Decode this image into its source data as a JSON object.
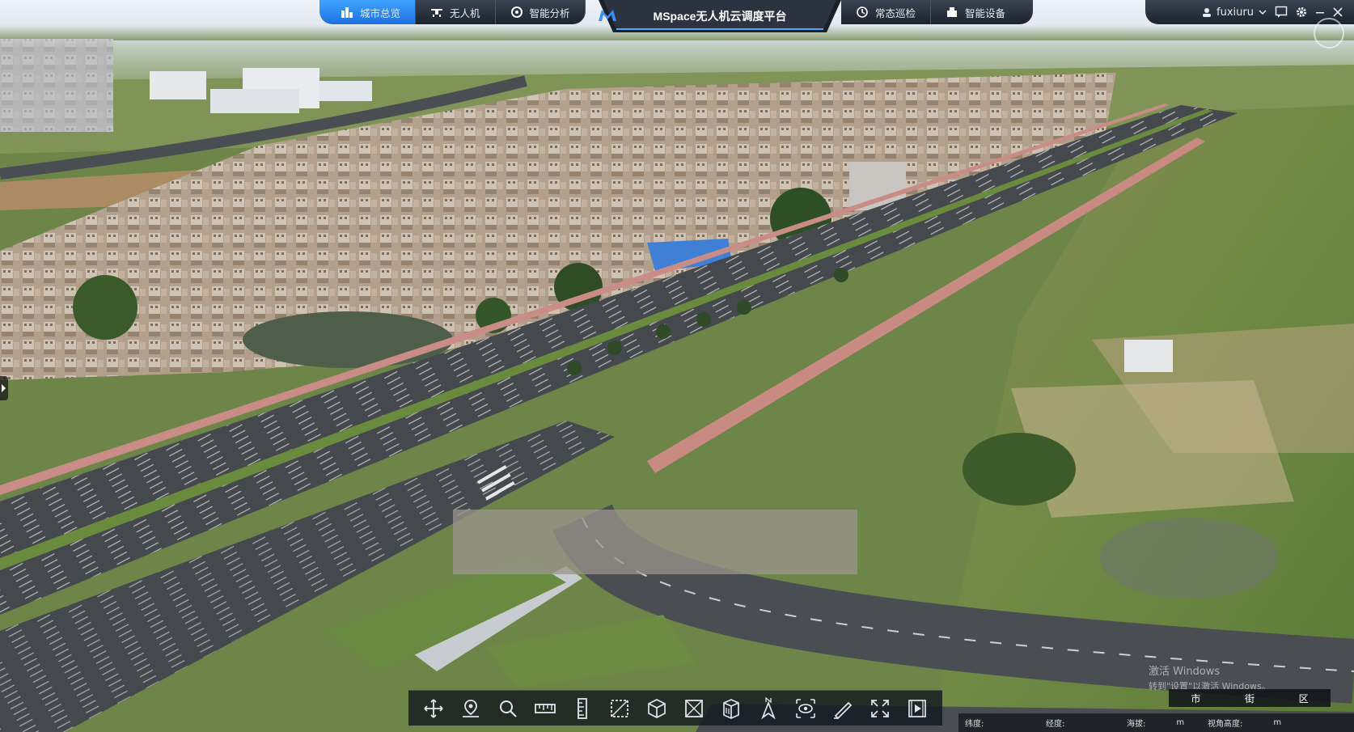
{
  "app": {
    "title": "MSpace无人机云调度平台",
    "logo_sub": "Space"
  },
  "nav": {
    "left_tabs": [
      {
        "label": "城市总览",
        "icon": "city-icon",
        "active": true
      },
      {
        "label": "无人机",
        "icon": "drone-icon",
        "active": false
      },
      {
        "label": "智能分析",
        "icon": "analysis-icon",
        "active": false
      }
    ],
    "right_tabs": [
      {
        "label": "常态巡检",
        "icon": "patrol-icon"
      },
      {
        "label": "智能设备",
        "icon": "device-icon"
      }
    ]
  },
  "user": {
    "name": "fuxiuru",
    "icons": [
      "user-icon",
      "chevron-down-icon",
      "message-icon",
      "gear-icon",
      "minimize-icon",
      "close-icon"
    ]
  },
  "toolbar": {
    "tools": [
      "move-icon",
      "location-icon",
      "search-icon",
      "ruler-icon",
      "height-measure-icon",
      "area-measure-icon",
      "cube-icon",
      "box-select-icon",
      "building-icon",
      "north-compass-icon",
      "view-icon",
      "draw-icon",
      "fullscreen-icon",
      "video-icon"
    ]
  },
  "region_switch": {
    "items": [
      "市",
      "街",
      "区"
    ]
  },
  "statusbar": {
    "latitude_label": "纬度:",
    "longitude_label": "经度:",
    "altitude_label": "海拔:",
    "altitude_unit": "m",
    "view_height_label": "视角高度:",
    "view_height_unit": "m"
  },
  "watermark": {
    "line1": "激活 Windows",
    "line2": "转到\"设置\"以激活 Windows。"
  },
  "colors": {
    "accent": "#2a86f2",
    "nav_dark": "#262d38",
    "road": "#4a4d52",
    "grass": "#5f7a3c"
  }
}
